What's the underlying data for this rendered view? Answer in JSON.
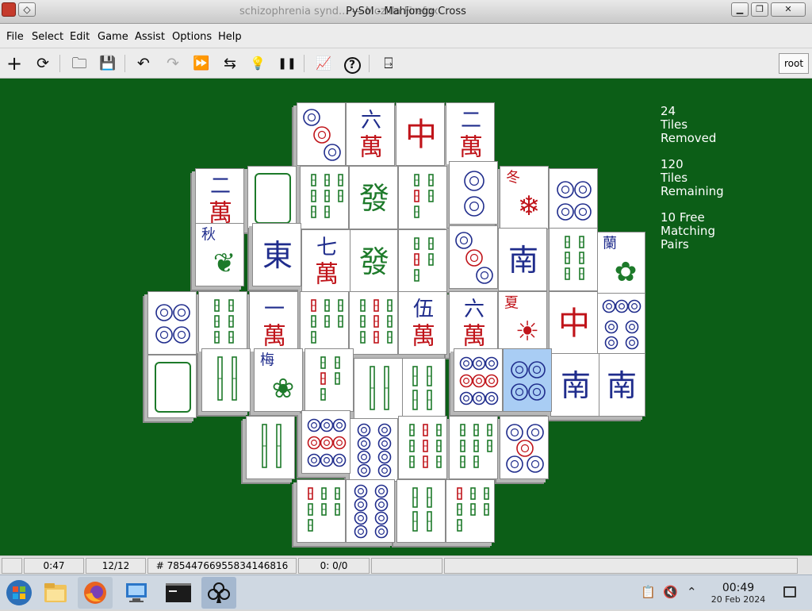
{
  "window": {
    "title": "PySol - Mahjongg Cross",
    "ghost_title": "schizophrenia synd... — Mozilla Firefox",
    "btn_min": "▁",
    "btn_max": "❐",
    "btn_close": "✕"
  },
  "menu": {
    "file": "File",
    "select": "Select",
    "edit": "Edit",
    "game": "Game",
    "assist": "Assist",
    "options": "Options",
    "help": "Help"
  },
  "toolbar": {
    "new_icon": "+",
    "restart_icon": "⟳",
    "open_icon": "🗀",
    "save_icon": "💾",
    "undo_icon": "↶",
    "redo_icon": "↷",
    "autodrop_icon": "⏩",
    "shuffle_icon": "⇆",
    "hint_icon": "💡",
    "pause_icon": "❚❚",
    "stats_icon": "📈",
    "rules_icon": "?",
    "quit_icon": "⍈",
    "player": "root"
  },
  "stats": {
    "removed_count": "24",
    "removed_line1": "Tiles",
    "removed_line2": "Removed",
    "remaining_count": "120",
    "remaining_line1": "Tiles",
    "remaining_line2": "Remaining",
    "pairs_count": "10 Free",
    "pairs_line1": "Matching",
    "pairs_line2": "Pairs"
  },
  "tiles": [
    {
      "kind": "circles",
      "n": 3
    },
    {
      "kind": "char",
      "top": "六",
      "bot": "萬"
    },
    {
      "kind": "red",
      "text": "中"
    },
    {
      "kind": "char",
      "top": "二",
      "bot": "萬"
    },
    {
      "kind": "char",
      "top": "二",
      "bot": "萬"
    },
    {
      "kind": "white"
    },
    {
      "kind": "bamboo",
      "n": 8
    },
    {
      "kind": "green",
      "text": "發"
    },
    {
      "kind": "bamboo",
      "n": 5
    },
    {
      "kind": "circles",
      "n": 2
    },
    {
      "kind": "season",
      "label": "冬",
      "sym": "❄"
    },
    {
      "kind": "circles",
      "n": 4
    },
    {
      "kind": "flower",
      "label": "秋",
      "sym": "❦"
    },
    {
      "kind": "wind",
      "text": "東"
    },
    {
      "kind": "char",
      "top": "七",
      "bot": "萬"
    },
    {
      "kind": "green",
      "text": "發"
    },
    {
      "kind": "bamboo",
      "n": 5
    },
    {
      "kind": "circles",
      "n": 3
    },
    {
      "kind": "wind",
      "text": "南"
    },
    {
      "kind": "bamboo",
      "n": 6
    },
    {
      "kind": "flower",
      "label": "蘭",
      "sym": "✿"
    },
    {
      "kind": "circles",
      "n": 4
    },
    {
      "kind": "bamboo",
      "n": 6
    },
    {
      "kind": "char",
      "top": "一",
      "bot": "萬"
    },
    {
      "kind": "bamboo",
      "n": 7
    },
    {
      "kind": "bamboo",
      "n": 9
    },
    {
      "kind": "char",
      "top": "伍",
      "bot": "萬"
    },
    {
      "kind": "char",
      "top": "六",
      "bot": "萬"
    },
    {
      "kind": "season",
      "label": "夏",
      "sym": "☀"
    },
    {
      "kind": "red",
      "text": "中"
    },
    {
      "kind": "circles",
      "n": 7
    },
    {
      "kind": "white"
    },
    {
      "kind": "bamboo",
      "n": 2
    },
    {
      "kind": "flower",
      "label": "梅",
      "sym": "❀"
    },
    {
      "kind": "bamboo",
      "n": 5
    },
    {
      "kind": "bamboo",
      "n": 2
    },
    {
      "kind": "bamboo",
      "n": 4
    },
    {
      "kind": "circles",
      "n": 9
    },
    {
      "kind": "circles",
      "n": 4,
      "selected": true
    },
    {
      "kind": "wind",
      "text": "南"
    },
    {
      "kind": "wind",
      "text": "南"
    },
    {
      "kind": "bamboo",
      "n": 2
    },
    {
      "kind": "circles",
      "n": 9
    },
    {
      "kind": "circles",
      "n": 8
    },
    {
      "kind": "bamboo",
      "n": 9
    },
    {
      "kind": "bamboo",
      "n": 8
    },
    {
      "kind": "circles",
      "n": 5
    },
    {
      "kind": "bamboo",
      "n": 7
    },
    {
      "kind": "circles",
      "n": 8
    },
    {
      "kind": "bamboo",
      "n": 4
    },
    {
      "kind": "bamboo",
      "n": 7
    }
  ],
  "status": {
    "time": "0:47",
    "moves": "12/12",
    "game_number": "# 78544766955834146816",
    "score": "0: 0/0"
  },
  "taskbar": {
    "clock_time": "00:49",
    "clock_date": "20 Feb 2024"
  }
}
